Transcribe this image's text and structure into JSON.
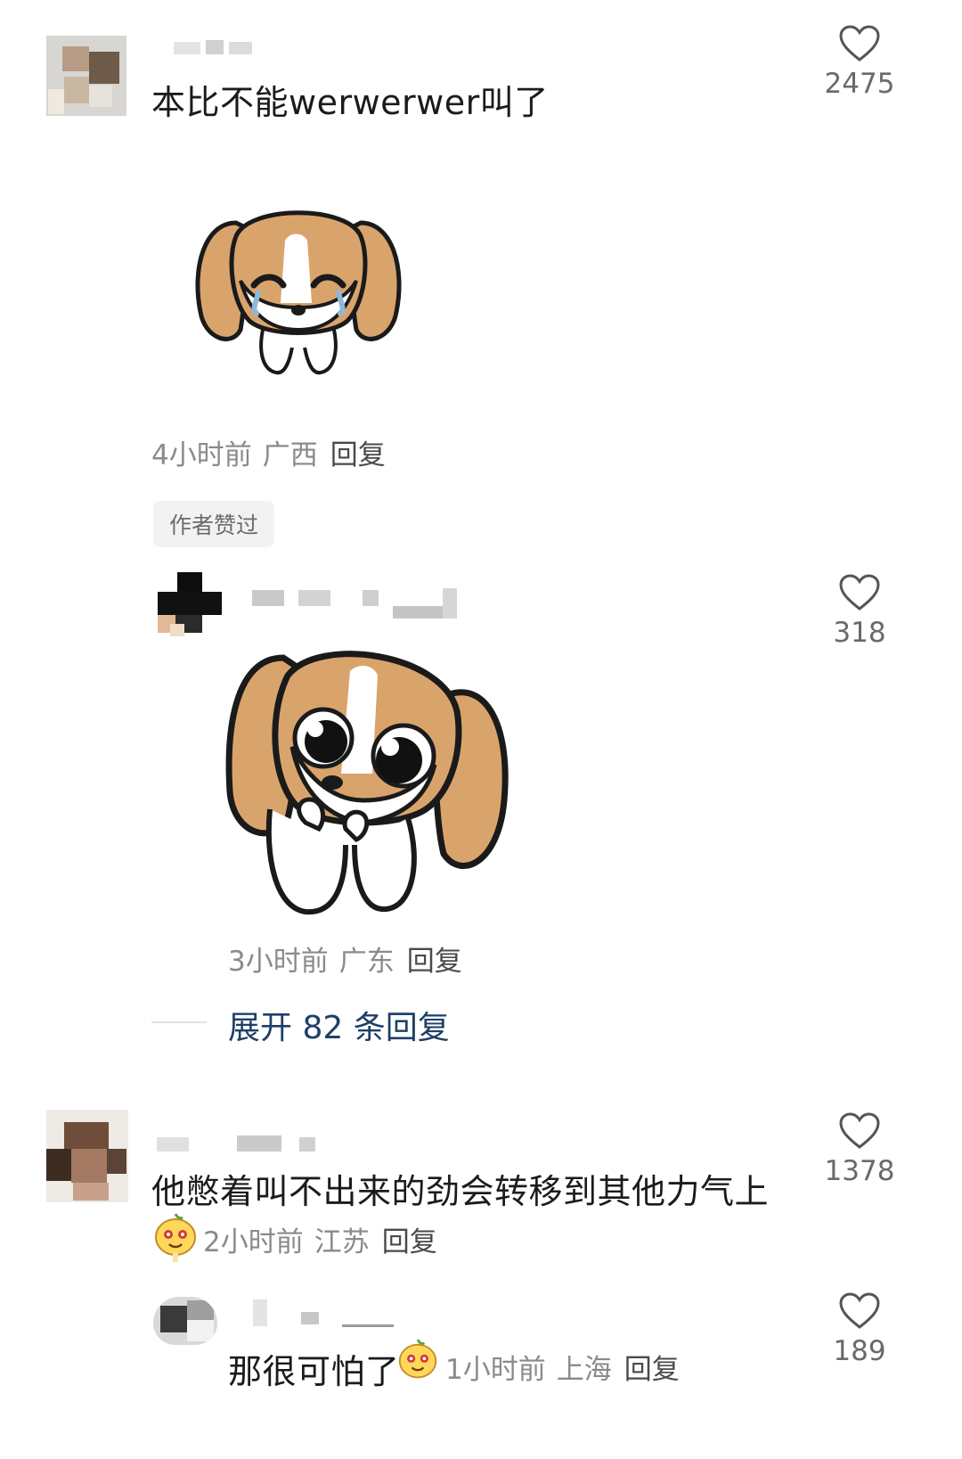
{
  "comments": [
    {
      "text": "本比不能werwerwer叫了",
      "time": "4小时前",
      "region": "广西",
      "reply_label": "回复",
      "likes": "2475",
      "badge": "作者赞过",
      "sticker": "crying-puppy-sticker"
    },
    {
      "time": "3小时前",
      "region": "广东",
      "reply_label": "回复",
      "likes": "318",
      "sticker": "begging-puppy-sticker",
      "expand_label": "展开 82 条回复"
    },
    {
      "text": "他憋着叫不出来的劲会转移到其他力气上",
      "time": "2小时前",
      "region": "江苏",
      "reply_label": "回复",
      "likes": "1378"
    },
    {
      "text": "那很可怕了",
      "time": "1小时前",
      "region": "上海",
      "reply_label": "回复",
      "likes": "189"
    }
  ],
  "colors": {
    "link": "#1f3f68",
    "meta": "#8a8a8a",
    "dog_tan": "#d9a46c",
    "emoji_yellow": "#ffd85a"
  }
}
